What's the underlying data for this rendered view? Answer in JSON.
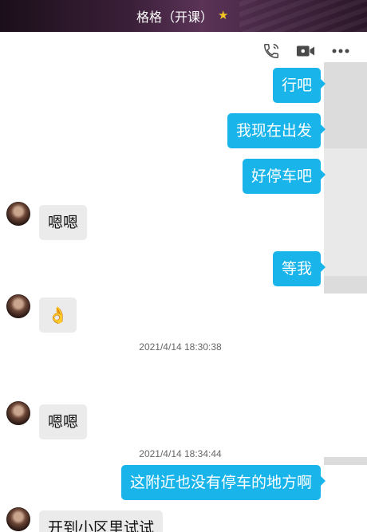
{
  "header": {
    "title": "格格（开课）",
    "badge_icon": "star-icon"
  },
  "toolbar": {
    "items": [
      "phone-icon",
      "video-call-icon",
      "more-icon"
    ]
  },
  "messages": [
    {
      "direction": "out",
      "text": "行吧"
    },
    {
      "direction": "out",
      "text": "我现在出发"
    },
    {
      "direction": "out",
      "text": "好停车吧"
    },
    {
      "direction": "in",
      "text": "嗯嗯"
    },
    {
      "direction": "out",
      "text": "等我"
    },
    {
      "direction": "in",
      "text": "👌"
    },
    {
      "type": "timestamp",
      "text": "2021/4/14 18:30:38"
    },
    {
      "direction": "in",
      "text": "嗯嗯"
    },
    {
      "type": "timestamp",
      "text": "2021/4/14 18:34:44"
    },
    {
      "direction": "out",
      "text": "这附近也没有停车的地方啊"
    },
    {
      "direction": "in",
      "text": "开到小区里试试"
    }
  ],
  "colors": {
    "outgoing_bubble": "#19b4e9",
    "incoming_bubble": "#ebebeb",
    "header_bg": "#2a1628"
  }
}
